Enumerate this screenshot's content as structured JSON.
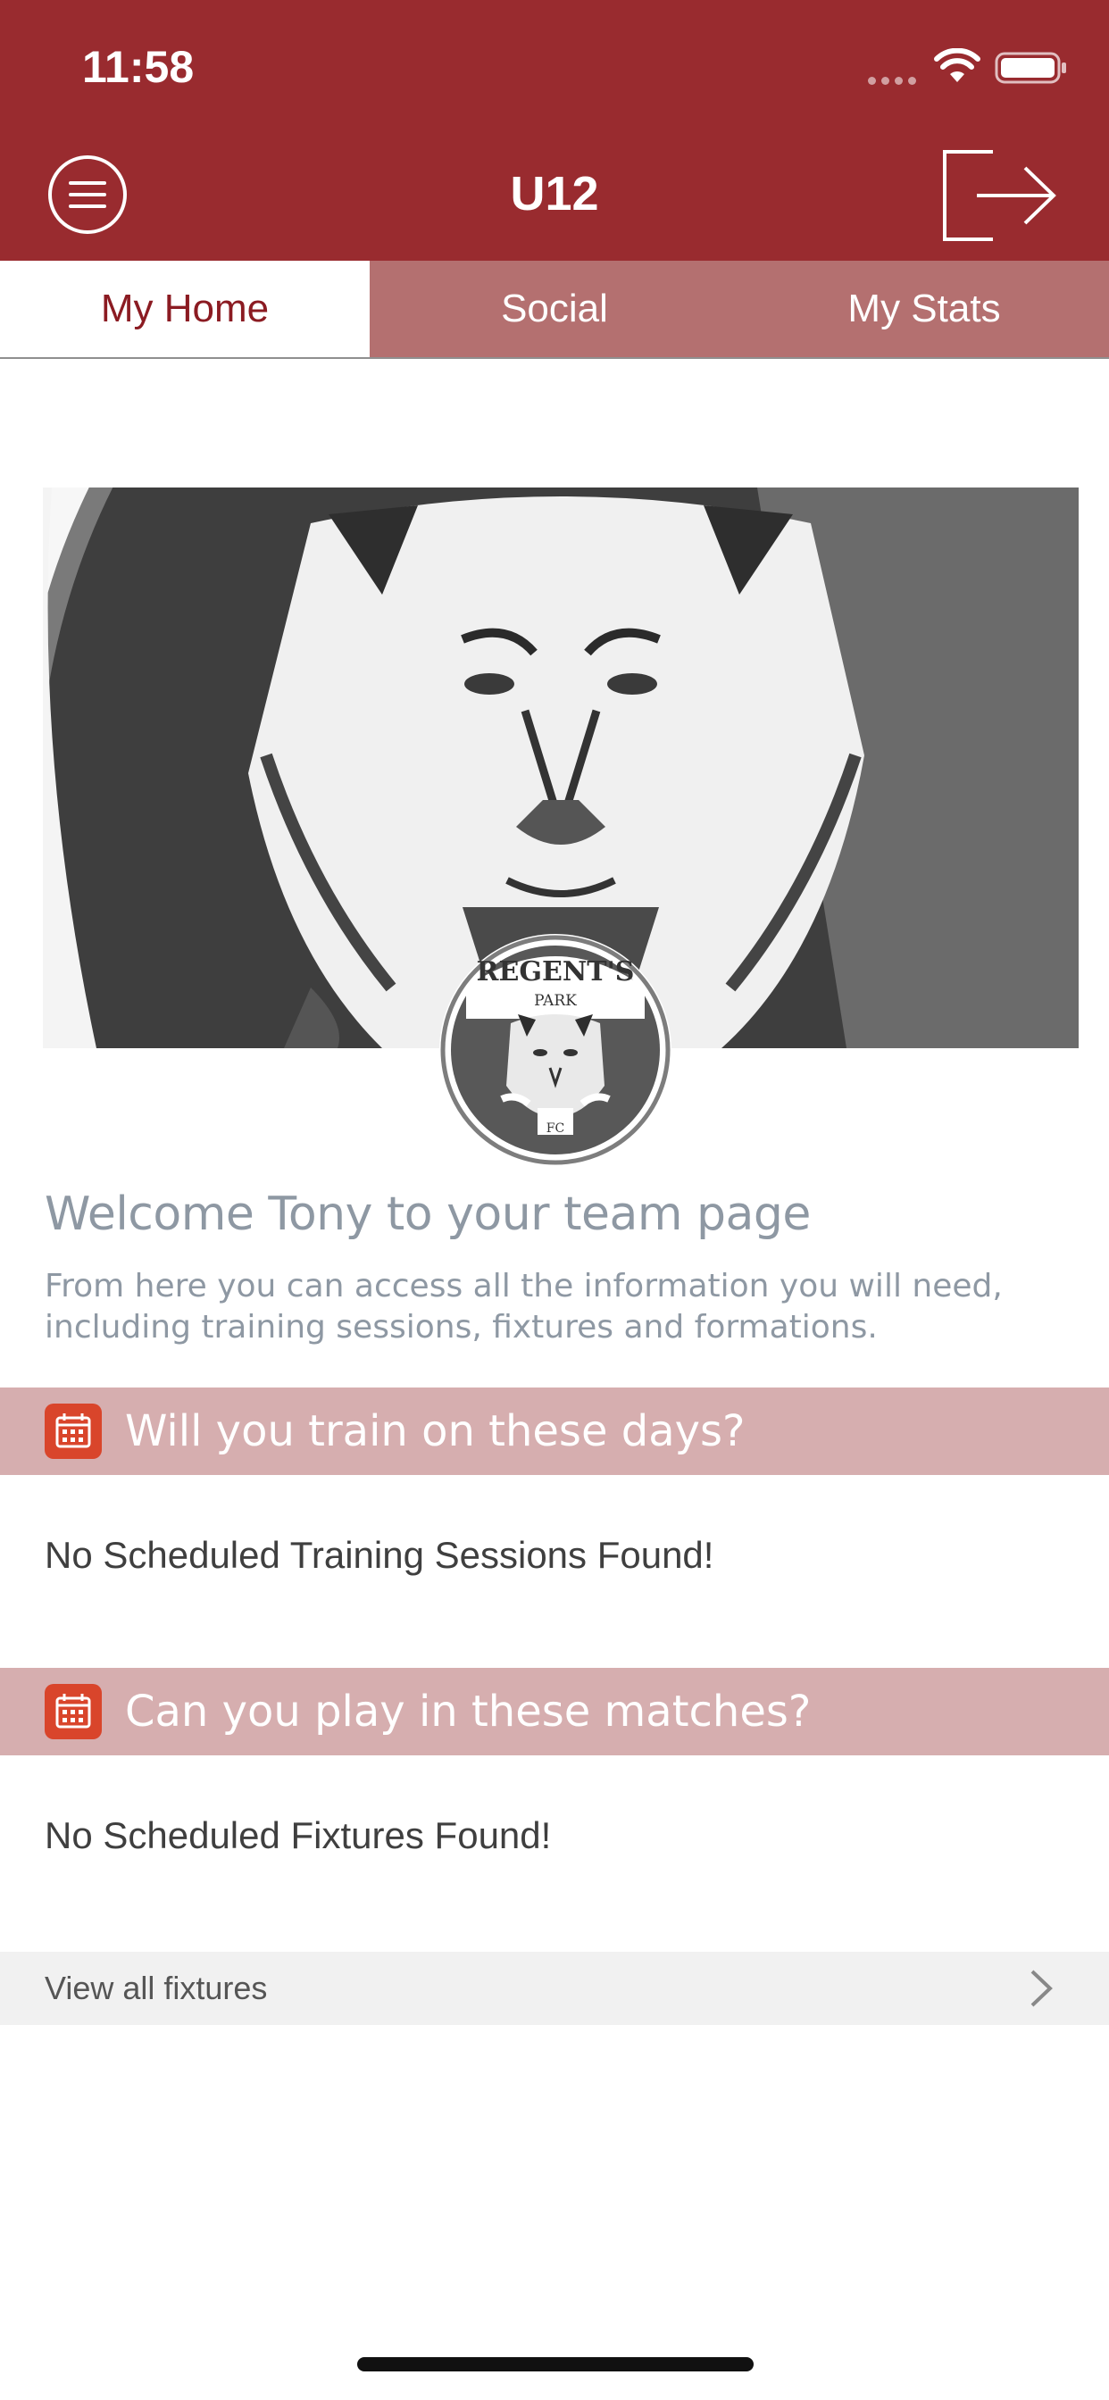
{
  "status_bar": {
    "time": "11:58"
  },
  "header": {
    "title": "U12"
  },
  "tabs": [
    {
      "label": "My Home",
      "active": true
    },
    {
      "label": "Social",
      "active": false
    },
    {
      "label": "My Stats",
      "active": false
    }
  ],
  "logo": {
    "top_text": "REGENT'S",
    "middle_text": "PARK",
    "bottom_text": "FC"
  },
  "welcome": {
    "title": "Welcome Tony to your team page",
    "text": "From here you can access all the information you will need, including training sessions, fixtures and formations."
  },
  "training": {
    "heading": "Will you train on these days?",
    "empty_message": "No Scheduled Training Sessions Found!"
  },
  "fixtures": {
    "heading": "Can you play in these matches?",
    "empty_message": "No Scheduled Fixtures Found!",
    "view_all_label": "View all fixtures"
  },
  "colors": {
    "header_bg": "#992b2f",
    "tab_active_text": "#8b1b22",
    "tab_inactive_bg": "#b47070",
    "section_bar_bg": "#d6aeaf",
    "calendar_icon": "#d9452b"
  },
  "icons": {
    "menu": "hamburger-menu-icon",
    "logout": "logout-arrow-icon",
    "calendar": "calendar-icon",
    "chevron": "chevron-right-icon",
    "wifi": "wifi-icon",
    "battery": "battery-icon"
  }
}
